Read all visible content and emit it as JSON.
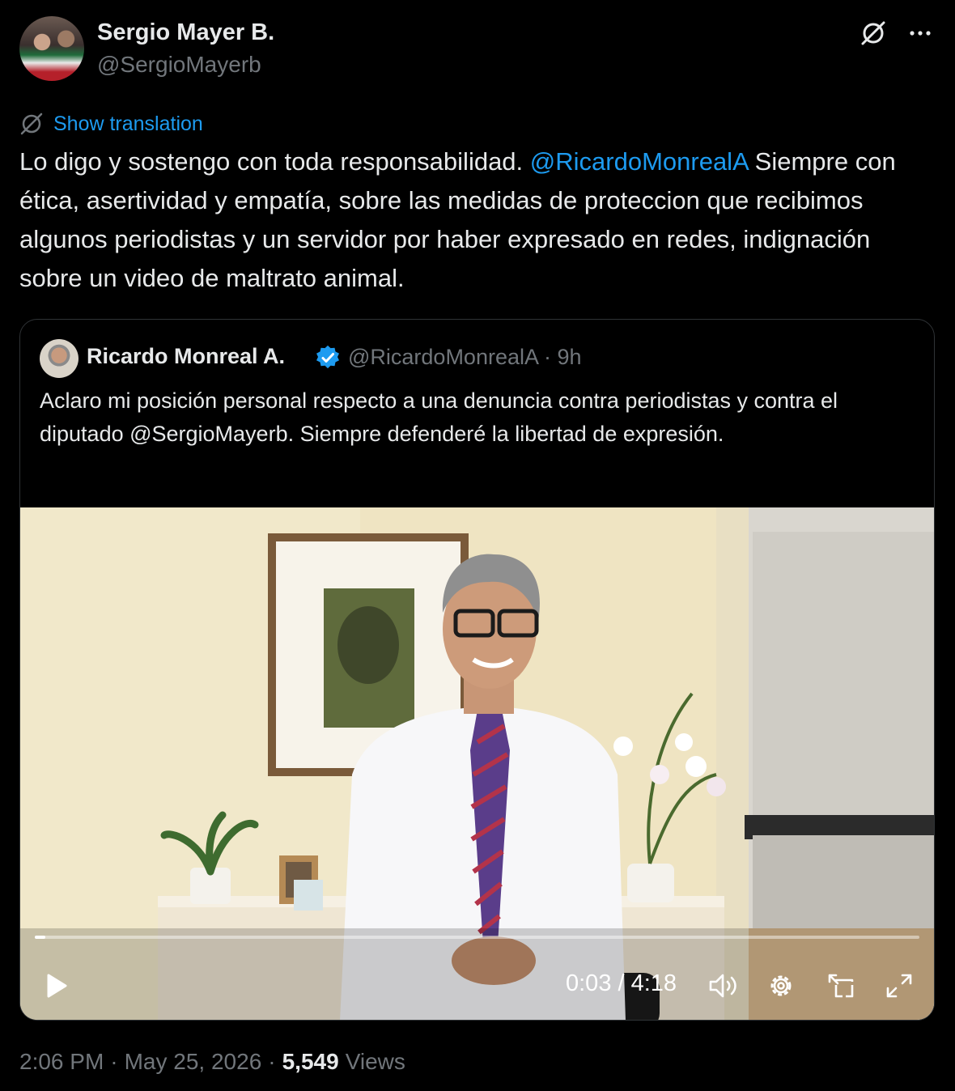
{
  "author": {
    "name": "Sergio Mayer B.",
    "handle": "@SergioMayerb"
  },
  "icons": {
    "grok": "grok-icon",
    "more": "more-icon",
    "translate": "translate-icon",
    "verified": "verified-badge-icon",
    "play": "play-icon",
    "volume": "volume-icon",
    "settings": "gear-icon",
    "pip": "picture-in-picture-icon",
    "fullscreen": "fullscreen-icon"
  },
  "translate_label": "Show translation",
  "tweet": {
    "text_part1": "Lo digo y sostengo con toda responsabilidad. ",
    "mention": "@RicardoMonrealA",
    "text_part2": " Siempre con ética, asertividad y empatía,  sobre las medidas de proteccion que recibimos  algunos periodistas y un servidor por haber expresado en redes, indignación sobre un video de  maltrato animal."
  },
  "quote": {
    "name": "Ricardo Monreal A.",
    "handle_time": "@RicardoMonrealA · 9h",
    "text": "Aclaro mi posición personal respecto a una denuncia contra periodistas y contra el diputado @SergioMayerb. Siempre defenderé la libertad de expresión."
  },
  "video": {
    "time": "0:03 / 4:18",
    "progress_fraction": 0.012
  },
  "footer": {
    "time": "2:06 PM",
    "sep1": "·",
    "date": "May 25, 2026",
    "sep2": "·",
    "views_count": "5,549",
    "views_label": "Views"
  },
  "colors": {
    "background": "#000000",
    "text": "#e7e9ea",
    "muted": "#71767b",
    "link": "#1d9bf0",
    "border": "#2f3336"
  }
}
